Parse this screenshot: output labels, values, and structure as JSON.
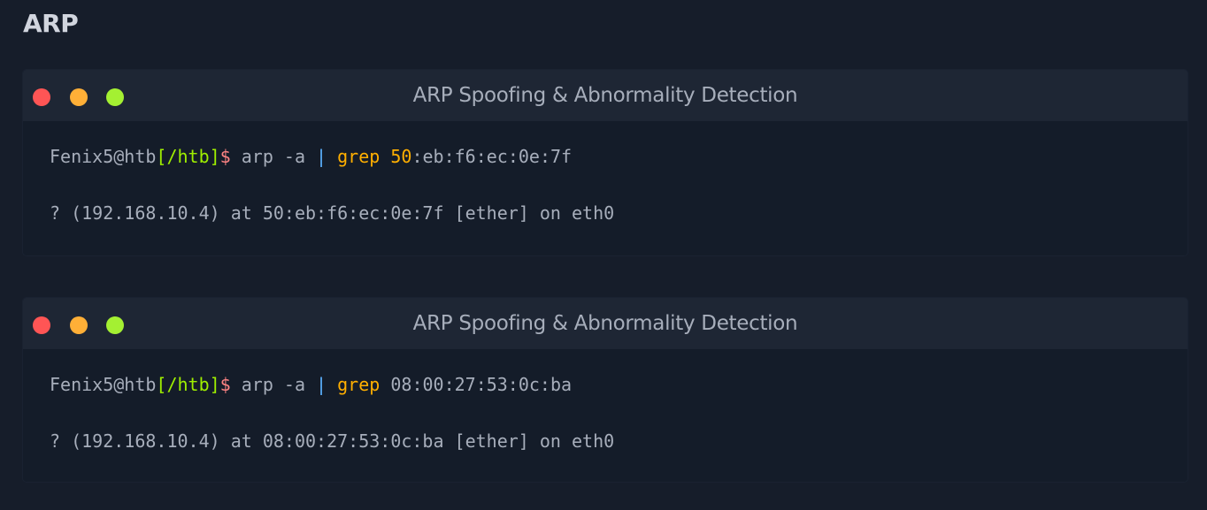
{
  "page": {
    "heading": "ARP"
  },
  "colors": {
    "background": "#161d2a",
    "terminal_bg": "#141c29",
    "titlebar_bg": "#1e2634",
    "dot_red": "#ff5555",
    "dot_yellow": "#ffaf37",
    "dot_green": "#a4f032",
    "prompt_path": "#9fef00",
    "prompt_dollar": "#ff8484",
    "pipe": "#5cb2ff",
    "command": "#ffaf00"
  },
  "terminals": [
    {
      "title": "ARP Spoofing & Abnormality Detection",
      "prompt_user": "Fenix5@htb",
      "prompt_path": "[/htb]",
      "prompt_symbol": "$",
      "cmd_part1": " arp -a ",
      "pipe": "|",
      "cmd_space": " ",
      "cmd_grep": "grep",
      "cmd_space2": " ",
      "arg_highlight": "50",
      "arg_rest": ":eb:f6:ec:0e:7f",
      "output": "? (192.168.10.4) at 50:eb:f6:ec:0e:7f [ether] on eth0"
    },
    {
      "title": "ARP Spoofing & Abnormality Detection",
      "prompt_user": "Fenix5@htb",
      "prompt_path": "[/htb]",
      "prompt_symbol": "$",
      "cmd_part1": " arp -a ",
      "pipe": "|",
      "cmd_space": " ",
      "cmd_grep": "grep",
      "cmd_space2": " ",
      "arg_highlight": "",
      "arg_rest": "08:00:27:53:0c:ba",
      "output": "? (192.168.10.4) at 08:00:27:53:0c:ba [ether] on eth0"
    }
  ]
}
